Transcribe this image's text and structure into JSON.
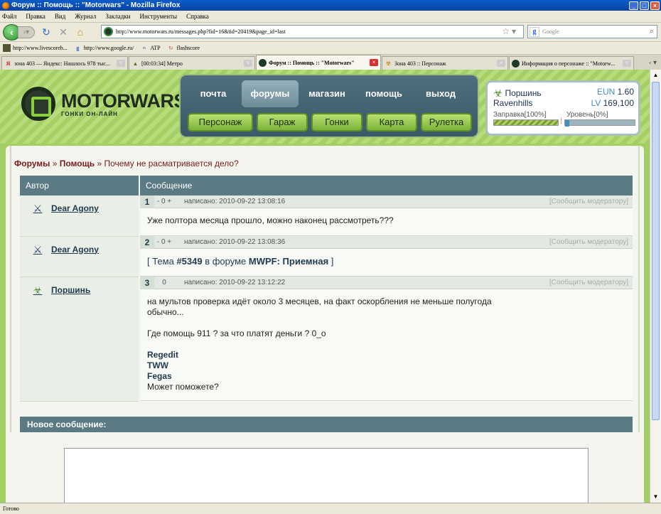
{
  "window": {
    "title": "Форум :: Помощь :: \"Motorwars\" - Mozilla Firefox"
  },
  "menu": [
    "Файл",
    "Правка",
    "Вид",
    "Журнал",
    "Закладки",
    "Инструменты",
    "Справка"
  ],
  "nav": {
    "url": "http://www.motorwars.ru/messages.php?fid=16&tid=20419&page_id=last",
    "search_placeholder": "Google"
  },
  "bookmarks": [
    "http://www.livescoreh...",
    "http://www.google.ru/",
    "ATP",
    "flashscore"
  ],
  "tabs": [
    {
      "label": "зона 403 — Яндекс: Нашлось 978 тыс..."
    },
    {
      "label": "[00:03:34] Метро"
    },
    {
      "label": "Форум :: Помощь :: \"Motorwars\""
    },
    {
      "label": "Зона 403 :: Персонаж"
    },
    {
      "label": "Информация о персонаже :: \"Motorw..."
    }
  ],
  "site": {
    "logo_title": "MOTORWARS.RU",
    "logo_sub": "ГОНКИ ОН-ЛАЙН",
    "nav_top": [
      "почта",
      "форумы",
      "магазин",
      "помощь",
      "выход"
    ],
    "nav_bottom": [
      "Персонаж",
      "Гараж",
      "Гонки",
      "Карта",
      "Рулетка"
    ],
    "user": {
      "name": "Поршинь",
      "city": "Ravenhills",
      "eun_label": "EUN",
      "eun_value": "1.60",
      "lv_label": "LV",
      "lv_value": "169,100",
      "fuel_label": "Заправка[100%]",
      "level_label": "Уровень[0%]",
      "fuel_pct": 100,
      "level_pct": 0
    }
  },
  "breadcrumb": {
    "forums": "Форумы",
    "sep1": " » ",
    "help": "Помощь",
    "sep2": " » ",
    "topic": "Почему не расматривается дело?"
  },
  "table": {
    "col_author": "Автор",
    "col_message": "Сообщение",
    "posts": [
      {
        "num": "1",
        "rating": "- 0 +",
        "date": "написано: 2010-09-22 13:08:16",
        "report": "[Сообщить модератору]",
        "author": "Dear Agony",
        "lines": [
          "Уже полтора месяца прошло, можно наконец рассмотреть???"
        ]
      },
      {
        "num": "2",
        "rating": "- 0 +",
        "date": "написано: 2010-09-22 13:08:36",
        "report": "[Сообщить модератору]",
        "author": "Dear Agony",
        "quote_prefix": "[ Тема ",
        "quote_num": "#5349",
        "quote_mid": " в форуме ",
        "quote_forum": "MWPF: Приемная",
        "quote_suffix": " ]"
      },
      {
        "num": "3",
        "rating": "0",
        "date": "написано: 2010-09-22 13:12:22",
        "report": "[Сообщить модератору]",
        "author": "Поршинь",
        "line1": "на мультов проверка идёт около 3 месяцев, на факт оскорбления не меньше полугода",
        "line2": "обычно...",
        "line3": "Где помощь 911 ? за что платят деньги ? 0_о",
        "bold1": "Regedit",
        "bold2": "TWW",
        "bold3": "Fegas",
        "line4": "Может поможете?"
      }
    ]
  },
  "new_message": "Новое сообщение:",
  "status": "Готово"
}
